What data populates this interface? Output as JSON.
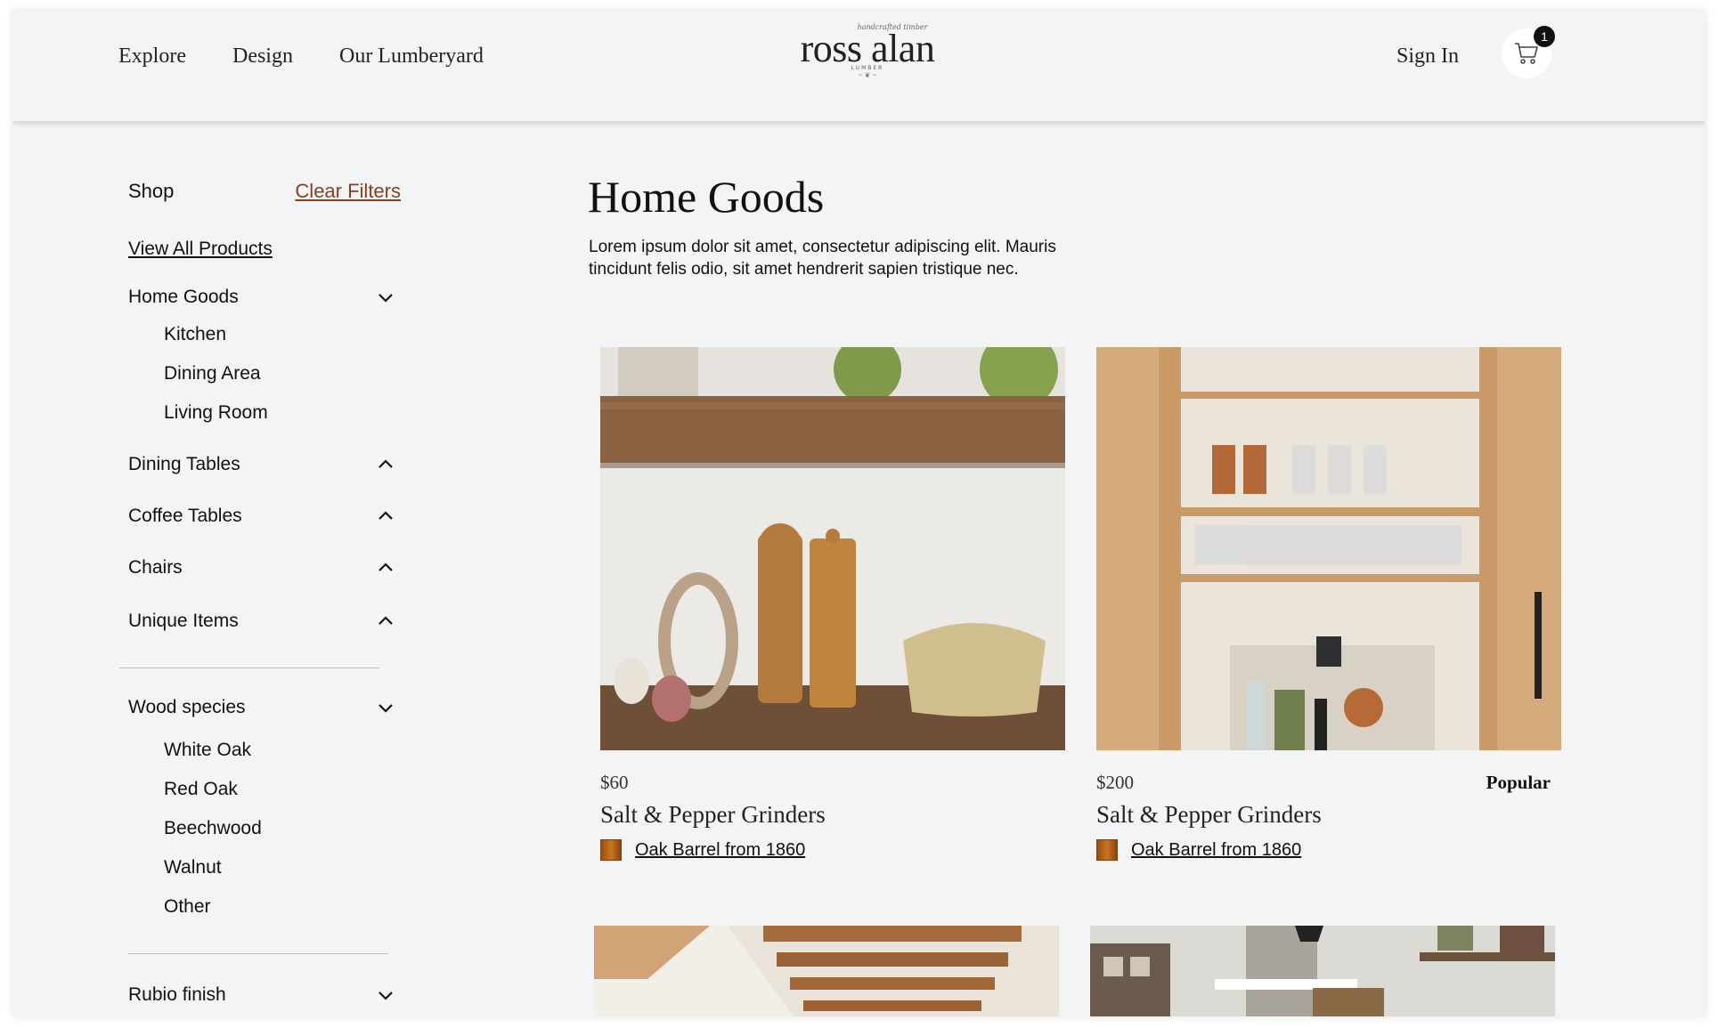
{
  "nav": {
    "items": [
      "Explore",
      "Design",
      "Our Lumberyard"
    ]
  },
  "logo": {
    "script": "handcrafted timber",
    "main": "ross alan",
    "sub": "LUMBER"
  },
  "header": {
    "sign_in": "Sign In",
    "cart_count": "1"
  },
  "sidebar": {
    "shop_label": "Shop",
    "clear_filters": "Clear Filters",
    "view_all": "View All Products",
    "categories": [
      {
        "label": "Home Goods",
        "expanded": true,
        "children": [
          "Kitchen",
          "Dining Area",
          "Living Room"
        ]
      },
      {
        "label": "Dining Tables",
        "expanded": false
      },
      {
        "label": "Coffee Tables",
        "expanded": false
      },
      {
        "label": "Chairs",
        "expanded": false
      },
      {
        "label": "Unique Items",
        "expanded": false
      }
    ],
    "wood_species": {
      "label": "Wood species",
      "options": [
        "White Oak",
        "Red Oak",
        "Beechwood",
        "Walnut",
        "Other"
      ]
    },
    "rubio": {
      "label": "Rubio finish"
    }
  },
  "main": {
    "title": "Home Goods",
    "description": "Lorem ipsum dolor sit amet, consectetur adipiscing elit. Mauris tincidunt felis odio, sit amet hendrerit sapien tristique nec."
  },
  "products": [
    {
      "price": "$60",
      "name": "Salt & Pepper Grinders",
      "wood": "Oak Barrel from 1860",
      "badge": ""
    },
    {
      "price": "$200",
      "name": "Salt & Pepper Grinders",
      "wood": "Oak Barrel from 1860",
      "badge": "Popular"
    }
  ],
  "colors": {
    "accent_link": "#8a3f1d",
    "background": "#f3f4f6",
    "text": "#111111"
  }
}
